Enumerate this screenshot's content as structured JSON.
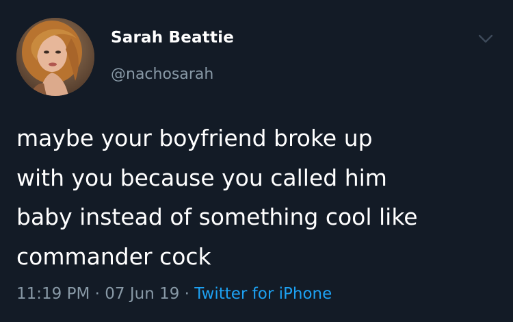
{
  "user": {
    "display_name": "Sarah Beattie",
    "handle": "@nachosarah"
  },
  "tweet": {
    "text_lines": [
      "maybe your boyfriend broke up",
      "with you because you called him",
      "baby instead of something cool like",
      "commander cock"
    ],
    "time": "11:19 PM",
    "separator": " · ",
    "date": "07 Jun 19",
    "source": "Twitter for iPhone"
  },
  "colors": {
    "background": "#131b26",
    "primary_text": "#ffffff",
    "secondary_text": "#8899a6",
    "link": "#1da1f2"
  },
  "icons": {
    "menu": "chevron-down-icon",
    "avatar": "profile-photo"
  }
}
